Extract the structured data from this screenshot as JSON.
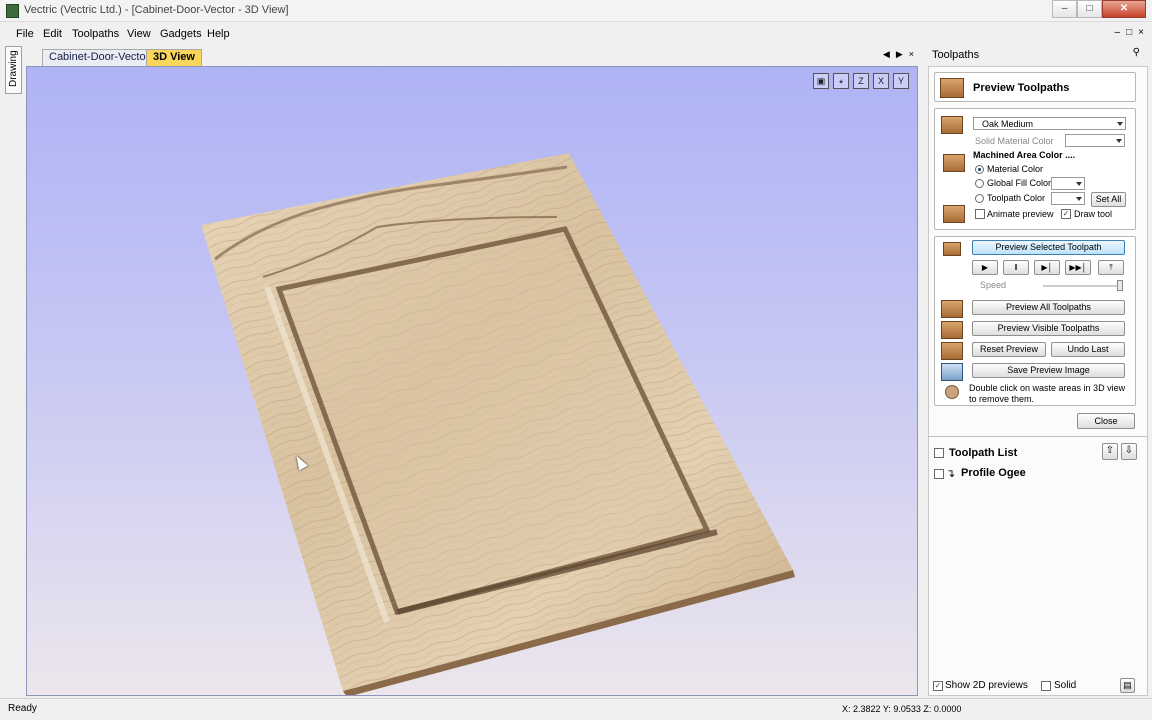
{
  "window": {
    "title": "Vectric (Vectric Ltd.) - [Cabinet-Door-Vector - 3D View]",
    "minimize_icon": "minimize-icon",
    "maximize_icon": "maximize-icon",
    "close_icon": "close-icon"
  },
  "menu": {
    "items": [
      "File",
      "Edit",
      "Toolpaths",
      "View",
      "Gadgets",
      "Help"
    ],
    "mdi_controls": [
      "–",
      "□",
      "×"
    ]
  },
  "sidebar": {
    "vertical_tab": "Drawing"
  },
  "doc_tabs": {
    "items": [
      "Cabinet-Door-Vector",
      "3D View"
    ],
    "active": "3D View",
    "controls": [
      "◀",
      "▶",
      "×"
    ]
  },
  "viewport": {
    "tools": [
      "fit-view-icon",
      "iso-view-icon",
      "z-axis-view-icon",
      "x-axis-view-icon",
      "y-axis-view-icon"
    ],
    "tool_glyphs": [
      "▣",
      "⭒",
      "Z",
      "X",
      "Y"
    ],
    "colors": {
      "sky_top": "#aeb3f4",
      "sky_bottom": "#ece6ec",
      "wood_light": "#e9d6b9",
      "wood_dark": "#9a7c59"
    }
  },
  "panel_header": {
    "title": "Toolpaths",
    "pin_icon": "pin-icon"
  },
  "preview": {
    "heading": "Preview Toolpaths",
    "material": "Oak Medium",
    "solid_material_label": "Solid Material Color",
    "machined_area_label": "Machined Area Color ....",
    "radio_options": [
      "Material Color",
      "Global Fill Color",
      "Toolpath Color"
    ],
    "selected_radio": "Material Color",
    "set_all": "Set All",
    "animate_label": "Animate preview",
    "animate_checked": false,
    "draw_tool_label": "Draw tool",
    "draw_tool_checked": true,
    "preview_selected": "Preview Selected Toolpath",
    "playback_icons": [
      "play-icon",
      "pause-icon",
      "step-icon",
      "fast-forward-icon",
      "skip-to-end-icon"
    ],
    "playback_glyphs": [
      "▶",
      "‖",
      "▶│",
      "▶▶│",
      "⤒"
    ],
    "speed_label": "Speed",
    "preview_all": "Preview All Toolpaths",
    "preview_visible": "Preview Visible Toolpaths",
    "reset_preview": "Reset Preview",
    "undo_last": "Undo Last",
    "save_preview_image": "Save Preview Image",
    "hint": "Double click on waste areas in 3D view to remove them.",
    "close": "Close"
  },
  "toolpath_list": {
    "title": "Toolpath List",
    "items": [
      {
        "name": "Profile Ogee",
        "checked": false
      }
    ]
  },
  "bottom_options": {
    "show_2d_label": "Show 2D previews",
    "show_2d_checked": true,
    "solid_label": "Solid",
    "solid_checked": false
  },
  "status": {
    "left": "Ready",
    "coords": "X: 2.3822 Y: 9.0533 Z: 0.0000"
  }
}
